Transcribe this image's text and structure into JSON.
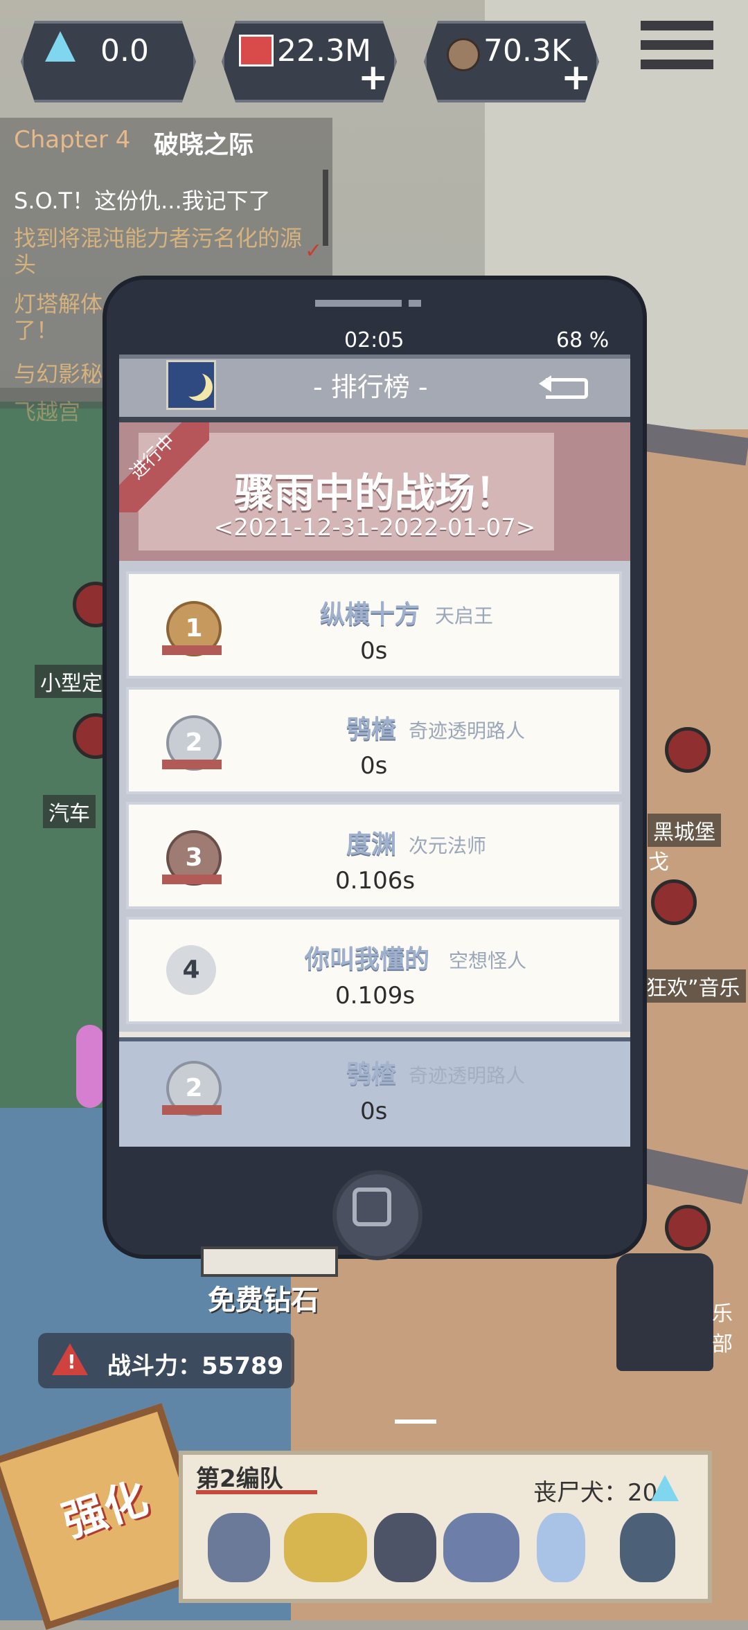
{
  "topbar": {
    "resources": [
      {
        "icon": "crystal-icon",
        "value": "0.0"
      },
      {
        "icon": "gem-pile-icon",
        "value": "22.3M"
      },
      {
        "icon": "coin-icon",
        "value": "70.3K"
      }
    ],
    "menu_icon": "hamburger-menu-icon"
  },
  "chapter": {
    "label": "Chapter 4",
    "name": "破晓之际",
    "quests": [
      "S.O.T！这份仇...我记下了",
      "找到将混沌能力者污名化的源头",
      "灯塔解体了！",
      "与幻影秘",
      "飞越宫"
    ]
  },
  "map": {
    "labels": [
      "小型定",
      "汽车",
      "黑城堡",
      "戈",
      "狂欢”音乐",
      "乐部"
    ]
  },
  "phone": {
    "status": {
      "time": "02:05",
      "battery": "68 %"
    },
    "title": "- 排行榜 -",
    "event": {
      "badge": "进行中",
      "title": "骤雨中的战场！",
      "date": "<2021-12-31-2022-01-07>"
    },
    "ranking": [
      {
        "rank": "1",
        "name": "纵横十方",
        "title": "天启王",
        "time": "0s"
      },
      {
        "rank": "2",
        "name": "鸮楂",
        "title": "奇迹透明路人",
        "time": "0s"
      },
      {
        "rank": "3",
        "name": "度渊",
        "title": "次元法师",
        "time": "0.106s"
      },
      {
        "rank": "4",
        "name": "你叫我懂的",
        "title": "空想怪人",
        "time": "0.109s"
      }
    ],
    "my_rank": {
      "rank": "2",
      "name": "鸮楂",
      "title": "奇迹透明路人",
      "time": "0s"
    }
  },
  "bottom": {
    "free_diamond": "免费钻石",
    "power": "战斗力：55789",
    "enhance": "强化",
    "squad": {
      "name": "第2编队",
      "zombie_dog": "丧尸犬：20"
    }
  },
  "colors": {
    "accent": "#b6565a",
    "panel": "#2c3140"
  }
}
